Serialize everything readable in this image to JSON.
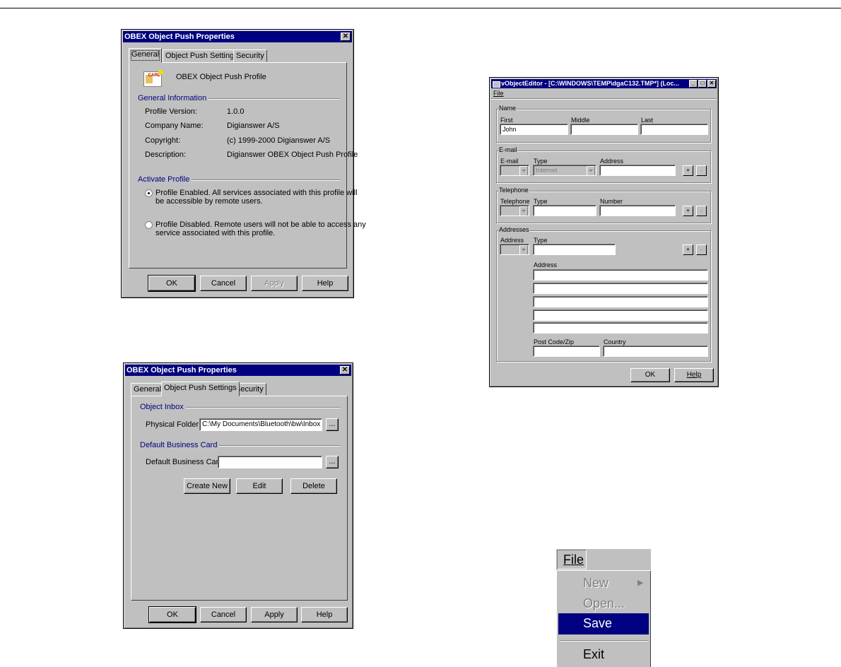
{
  "win1": {
    "title": "OBEX Object Push Properties",
    "close_glyph": "✕",
    "tabs": [
      "General",
      "Object Push Settings",
      "Security"
    ],
    "profile_name": "OBEX Object Push Profile",
    "icon_badge": "CARD",
    "general_info_title": "General Information",
    "info_labels": [
      "Profile Version:",
      "Company Name:",
      "Copyright:",
      "Description:"
    ],
    "info_values": [
      "1.0.0",
      "Digianswer A/S",
      "(c) 1999-2000 Digianswer A/S",
      "Digianswer OBEX Object Push Profile"
    ],
    "activate_title": "Activate Profile",
    "radio_enabled": [
      "Profile Enabled. All services associated with this profile will",
      "be accessible by remote users."
    ],
    "radio_disabled": [
      "Profile Disabled. Remote users will not be able to access any",
      "service associated with this profile."
    ],
    "buttons": [
      "OK",
      "Cancel",
      "Apply",
      "Help"
    ]
  },
  "win2": {
    "title": "OBEX Object Push Properties",
    "close_glyph": "✕",
    "tabs": [
      "General",
      "Object Push Settings",
      "Security"
    ],
    "inbox_title": "Object Inbox",
    "physical_folder_label": "Physical Folder:",
    "physical_folder_value": "C:\\My Documents\\Bluetooth\\bw\\Inbox",
    "browse_label": "...",
    "card_title": "Default Business Card",
    "card_label": "Default Business Card:",
    "card_value": "",
    "card_buttons": [
      "Create New",
      "Edit",
      "Delete"
    ],
    "buttons": [
      "OK",
      "Cancel",
      "Apply",
      "Help"
    ]
  },
  "editor": {
    "title": "vObjectEditor - [C:\\WINDOWS\\TEMP\\dgaC132.TMP*] (Loc...",
    "menu_file": "File",
    "tb_glyphs": [
      "_",
      "□",
      "✕"
    ],
    "name_frame": "Name",
    "name_labels": [
      "First",
      "Middle",
      "Last"
    ],
    "name_values": [
      "John",
      "",
      ""
    ],
    "email_frame": "E-mail",
    "email_labels": [
      "E-mail",
      "Type",
      "Address"
    ],
    "email_type_value": "Internet",
    "tel_frame": "Telephone",
    "tel_labels": [
      "Telephone",
      "Type",
      "Number"
    ],
    "addr_frame": "Addresses",
    "addr_labels": [
      "Address",
      "Type"
    ],
    "addr_lines_label": "Address",
    "postcode_label": "Post Code/Zip",
    "country_label": "Country",
    "plus": "+",
    "minus": "-",
    "buttons": [
      "OK",
      "Help"
    ]
  },
  "file_menu": {
    "header": "File",
    "items": [
      "New",
      "Open...",
      "Save",
      "Exit"
    ],
    "submenu_arrow": "▶"
  }
}
